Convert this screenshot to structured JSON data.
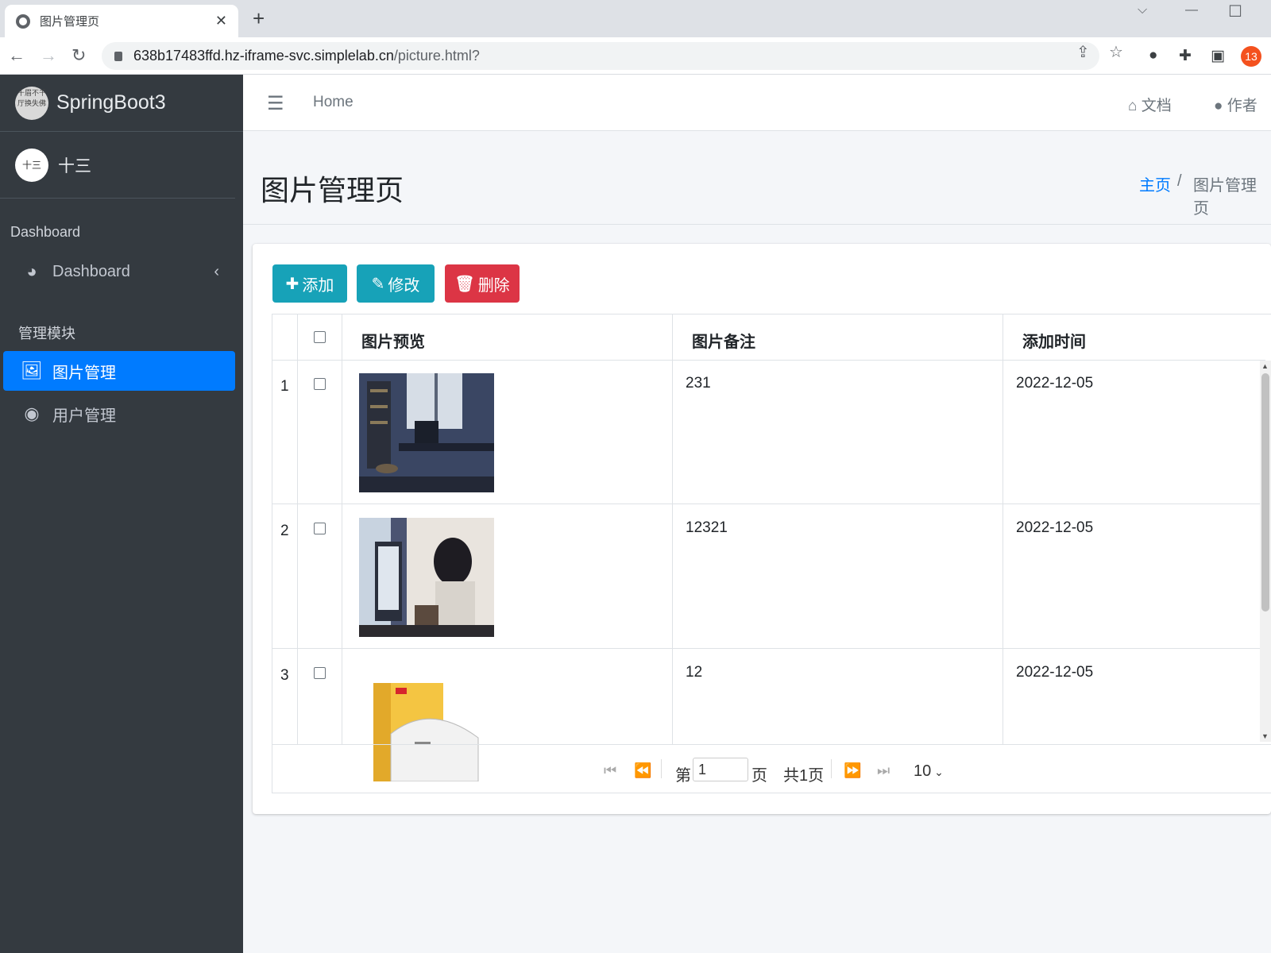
{
  "browser": {
    "tab_title": "图片管理页",
    "url_host": "638b17483ffd.hz-iframe-svc.simplelab.cn",
    "url_path": "/picture.html?",
    "ext_badge": "13"
  },
  "sidebar": {
    "brand": "SpringBoot3",
    "brand_logo_text": "十眉不千厅换失佛",
    "user_name": "十三",
    "user_avatar_text": "十三",
    "section_dashboard": "Dashboard",
    "dashboard_item": "Dashboard",
    "section_modules": "管理模块",
    "item_picture": "图片管理",
    "item_user": "用户管理"
  },
  "topnav": {
    "home": "Home",
    "docs": "文档",
    "author": "作者"
  },
  "header": {
    "title": "图片管理页",
    "breadcrumb_home": "主页",
    "breadcrumb_sep": "/",
    "breadcrumb_current": "图片管理页"
  },
  "toolbar": {
    "add": "添加",
    "edit": "修改",
    "delete": "删除"
  },
  "table": {
    "columns": [
      "图片预览",
      "图片备注",
      "添加时间"
    ],
    "rows": [
      {
        "index": "1",
        "remark": "231",
        "date": "2022-12-05"
      },
      {
        "index": "2",
        "remark": "12321",
        "date": "2022-12-05"
      },
      {
        "index": "3",
        "remark": "12",
        "date": "2022-12-05"
      }
    ]
  },
  "pager": {
    "prefix": "第",
    "page_value": "1",
    "suffix": "页",
    "total": "共1页",
    "page_size": "10"
  },
  "colors": {
    "sidebar_bg": "#343a40",
    "primary": "#007bff",
    "info": "#17a2b8",
    "danger": "#dc3545"
  },
  "icons": {
    "add": "plus-icon",
    "edit": "edit-icon",
    "delete": "trash-icon",
    "picture": "image-icon",
    "user": "user-circle-icon",
    "dashboard": "palette-icon",
    "docs": "home-icon",
    "author": "user-icon"
  }
}
